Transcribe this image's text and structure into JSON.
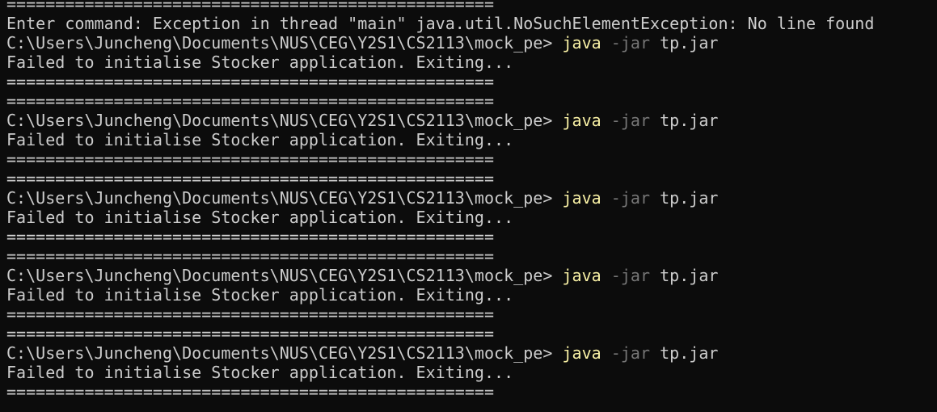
{
  "terminal": {
    "colors": {
      "background": "#0c0c0c",
      "foreground": "#cccccc",
      "command": "#f9f1a5",
      "flag": "#767676"
    },
    "lines": {
      "l0": "==================================================",
      "l1": "Enter command: Exception in thread \"main\" java.util.NoSuchElementException: No line found",
      "l2": {
        "prompt": "C:\\Users\\Juncheng\\Documents\\NUS\\CEG\\Y2S1\\CS2113\\mock_pe> ",
        "cmd": "java",
        "flag": "-jar",
        "arg": "tp.jar"
      },
      "l3": "Failed to initialise Stocker application. Exiting...",
      "l4": "==================================================",
      "l5": "==================================================",
      "l6": {
        "prompt": "C:\\Users\\Juncheng\\Documents\\NUS\\CEG\\Y2S1\\CS2113\\mock_pe> ",
        "cmd": "java",
        "flag": "-jar",
        "arg": "tp.jar"
      },
      "l7": "Failed to initialise Stocker application. Exiting...",
      "l8": "==================================================",
      "l9": "==================================================",
      "l10": {
        "prompt": "C:\\Users\\Juncheng\\Documents\\NUS\\CEG\\Y2S1\\CS2113\\mock_pe> ",
        "cmd": "java",
        "flag": "-jar",
        "arg": "tp.jar"
      },
      "l11": "Failed to initialise Stocker application. Exiting...",
      "l12": "==================================================",
      "l13": "==================================================",
      "l14": {
        "prompt": "C:\\Users\\Juncheng\\Documents\\NUS\\CEG\\Y2S1\\CS2113\\mock_pe> ",
        "cmd": "java",
        "flag": "-jar",
        "arg": "tp.jar"
      },
      "l15": "Failed to initialise Stocker application. Exiting...",
      "l16": "==================================================",
      "l17": "==================================================",
      "l18": {
        "prompt": "C:\\Users\\Juncheng\\Documents\\NUS\\CEG\\Y2S1\\CS2113\\mock_pe> ",
        "cmd": "java",
        "flag": "-jar",
        "arg": "tp.jar"
      },
      "l19": "Failed to initialise Stocker application. Exiting...",
      "l20": "=================================================="
    }
  }
}
